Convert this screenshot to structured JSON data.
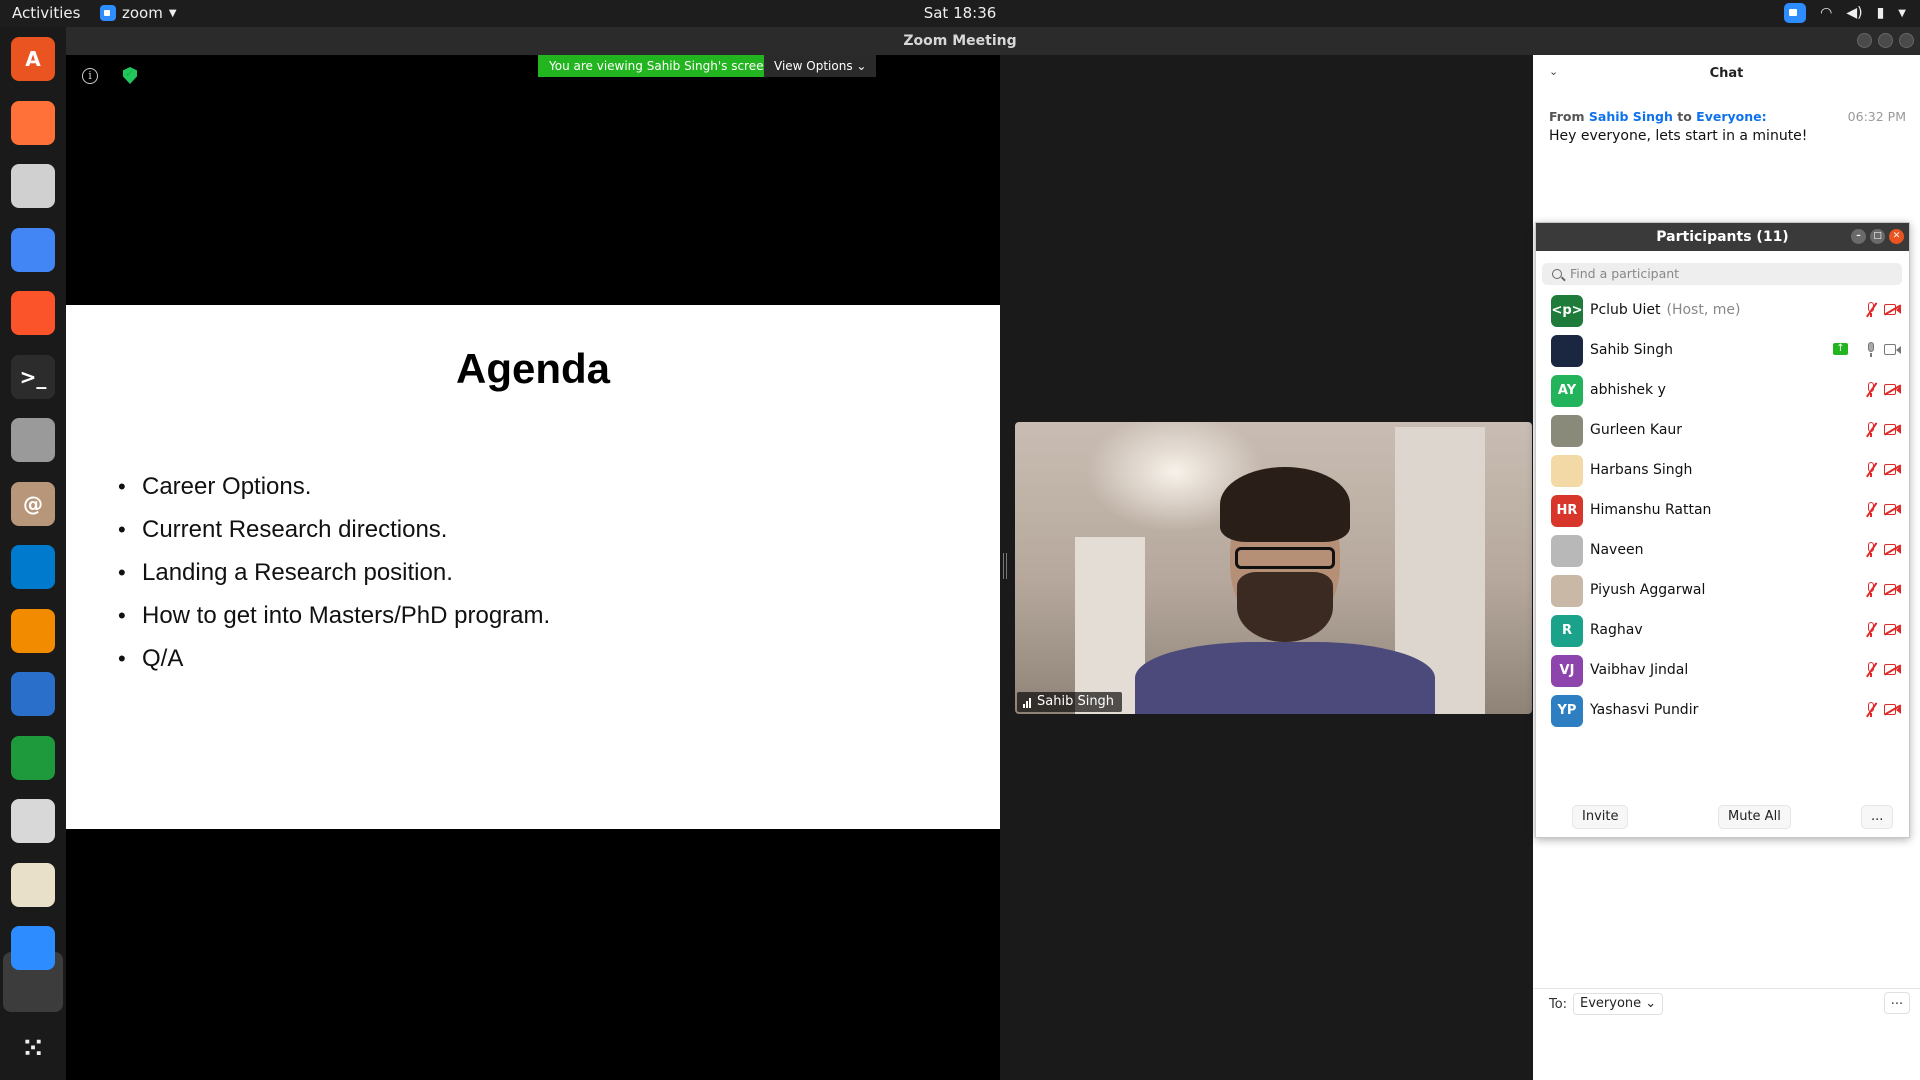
{
  "topbar": {
    "activities": "Activities",
    "app_name": "zoom",
    "clock": "Sat 18:36"
  },
  "window": {
    "title": "Zoom Meeting"
  },
  "dock": {
    "items": [
      {
        "name": "ubuntu-software",
        "color": "#e95420",
        "glyph": "A"
      },
      {
        "name": "firefox",
        "color": "#ff7139",
        "glyph": ""
      },
      {
        "name": "files",
        "color": "#d0d0d0",
        "glyph": ""
      },
      {
        "name": "chrome",
        "color": "#4285f4",
        "glyph": ""
      },
      {
        "name": "brave",
        "color": "#fb542b",
        "glyph": ""
      },
      {
        "name": "terminal",
        "color": "#2c2c2c",
        "glyph": ">_"
      },
      {
        "name": "camera",
        "color": "#9a9a9a",
        "glyph": ""
      },
      {
        "name": "archive",
        "color": "#b8967a",
        "glyph": "@"
      },
      {
        "name": "vscode",
        "color": "#007acc",
        "glyph": ""
      },
      {
        "name": "vlc",
        "color": "#f28b00",
        "glyph": ""
      },
      {
        "name": "writer",
        "color": "#2a6fc9",
        "glyph": ""
      },
      {
        "name": "calc",
        "color": "#1e9a3c",
        "glyph": ""
      },
      {
        "name": "evince",
        "color": "#d8d8d8",
        "glyph": ""
      },
      {
        "name": "text-editor",
        "color": "#e8e0c8",
        "glyph": ""
      },
      {
        "name": "zoom",
        "color": "#2d8cff",
        "glyph": ""
      }
    ],
    "apps_grid": "⋮⋮⋮"
  },
  "share": {
    "banner": "You are viewing Sahib Singh's screen",
    "view_options": "View Options ⌄",
    "slide": {
      "title": "Agenda",
      "bullets": [
        "Career Options.",
        "Current Research directions.",
        "Landing a Research position.",
        "How to get into Masters/PhD program.",
        "Q/A"
      ]
    }
  },
  "video": {
    "name": "Sahib Singh"
  },
  "chat": {
    "title": "Chat",
    "message": {
      "from_label": "From",
      "sender": "Sahib Singh",
      "to_label": "to",
      "recipient": "Everyone:",
      "time": "06:32 PM",
      "text": "Hey everyone, lets start in a minute!"
    },
    "to_prefix": "To:",
    "to_value": "Everyone ⌄",
    "more": "..."
  },
  "participants": {
    "title": "Participants (11)",
    "search_placeholder": "Find a participant",
    "list": [
      {
        "name": "Pclub Uiet",
        "role": "(Host, me)",
        "initials": "<p>",
        "color": "#1e7b3a",
        "mic_on": false,
        "cam_on": false,
        "sharing": false
      },
      {
        "name": "Sahib Singh",
        "role": "",
        "initials": "",
        "color": "#1b2740",
        "mic_on": true,
        "cam_on": true,
        "sharing": true
      },
      {
        "name": "abhishek y",
        "role": "",
        "initials": "AY",
        "color": "#23b35a",
        "mic_on": false,
        "cam_on": false,
        "sharing": false
      },
      {
        "name": "Gurleen Kaur",
        "role": "",
        "initials": "",
        "color": "#8a8a7a",
        "mic_on": false,
        "cam_on": false,
        "sharing": false
      },
      {
        "name": "Harbans Singh",
        "role": "",
        "initials": "",
        "color": "#f2d9a6",
        "mic_on": false,
        "cam_on": false,
        "sharing": false
      },
      {
        "name": "Himanshu Rattan",
        "role": "",
        "initials": "HR",
        "color": "#d9362b",
        "mic_on": false,
        "cam_on": false,
        "sharing": false
      },
      {
        "name": "Naveen",
        "role": "",
        "initials": "",
        "color": "#b8b8b8",
        "mic_on": false,
        "cam_on": false,
        "sharing": false
      },
      {
        "name": "Piyush Aggarwal",
        "role": "",
        "initials": "",
        "color": "#c9b8a6",
        "mic_on": false,
        "cam_on": false,
        "sharing": false
      },
      {
        "name": "Raghav",
        "role": "",
        "initials": "R",
        "color": "#1aa38a",
        "mic_on": false,
        "cam_on": false,
        "sharing": false
      },
      {
        "name": "Vaibhav Jindal",
        "role": "",
        "initials": "VJ",
        "color": "#8e44ad",
        "mic_on": false,
        "cam_on": false,
        "sharing": false
      },
      {
        "name": "Yashasvi Pundir",
        "role": "",
        "initials": "YP",
        "color": "#2d7fc1",
        "mic_on": false,
        "cam_on": false,
        "sharing": false
      }
    ],
    "invite": "Invite",
    "mute_all": "Mute All",
    "more": "..."
  }
}
